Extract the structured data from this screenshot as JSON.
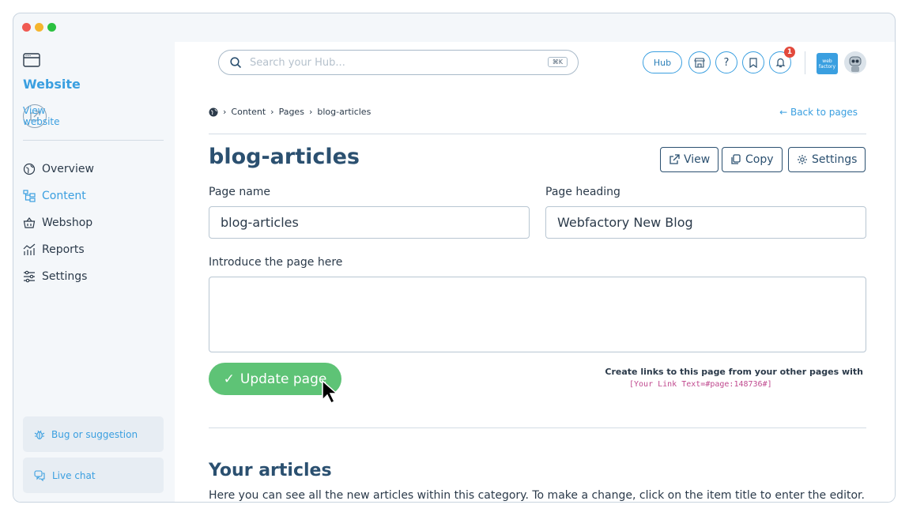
{
  "colors": {
    "accent": "#3a9fe0",
    "primary": "#2b5070",
    "success": "#5ec376",
    "danger": "#e2493c",
    "code": "#c04a8f"
  },
  "sidebar": {
    "site_title": "Website",
    "view_website": "View website",
    "nav": [
      {
        "label": "Overview",
        "icon": "globe-icon",
        "active": false
      },
      {
        "label": "Content",
        "icon": "sitemap-icon",
        "active": true
      },
      {
        "label": "Webshop",
        "icon": "basket-icon",
        "active": false
      },
      {
        "label": "Reports",
        "icon": "chart-icon",
        "active": false
      },
      {
        "label": "Settings",
        "icon": "sliders-icon",
        "active": false
      }
    ],
    "bug_label": "Bug or suggestion",
    "chat_label": "Live chat"
  },
  "topbar": {
    "search_placeholder": "Search your Hub...",
    "search_shortcut": "⌘K",
    "hub_label": "Hub",
    "notification_count": "1",
    "logo_text": "web factory"
  },
  "breadcrumb": {
    "items": [
      "Content",
      "Pages",
      "blog-articles"
    ],
    "home_icon": "globe-icon"
  },
  "back_link": "← Back to pages",
  "page": {
    "title": "blog-articles",
    "actions": {
      "view": "View",
      "copy": "Copy",
      "settings": "Settings"
    },
    "page_name_label": "Page name",
    "page_name_value": "blog-articles",
    "page_heading_label": "Page heading",
    "page_heading_value": "Webfactory New Blog",
    "intro_label": "Introduce the page here",
    "intro_value": "",
    "update_button": "Update page",
    "links_hint": "Create links to this page from your other pages with",
    "links_code": "[Your Link Text=#page:148736#]"
  },
  "articles": {
    "title": "Your articles",
    "description": "Here you can see all the new articles within this category. To make a change, click on the item title to enter the editor."
  }
}
